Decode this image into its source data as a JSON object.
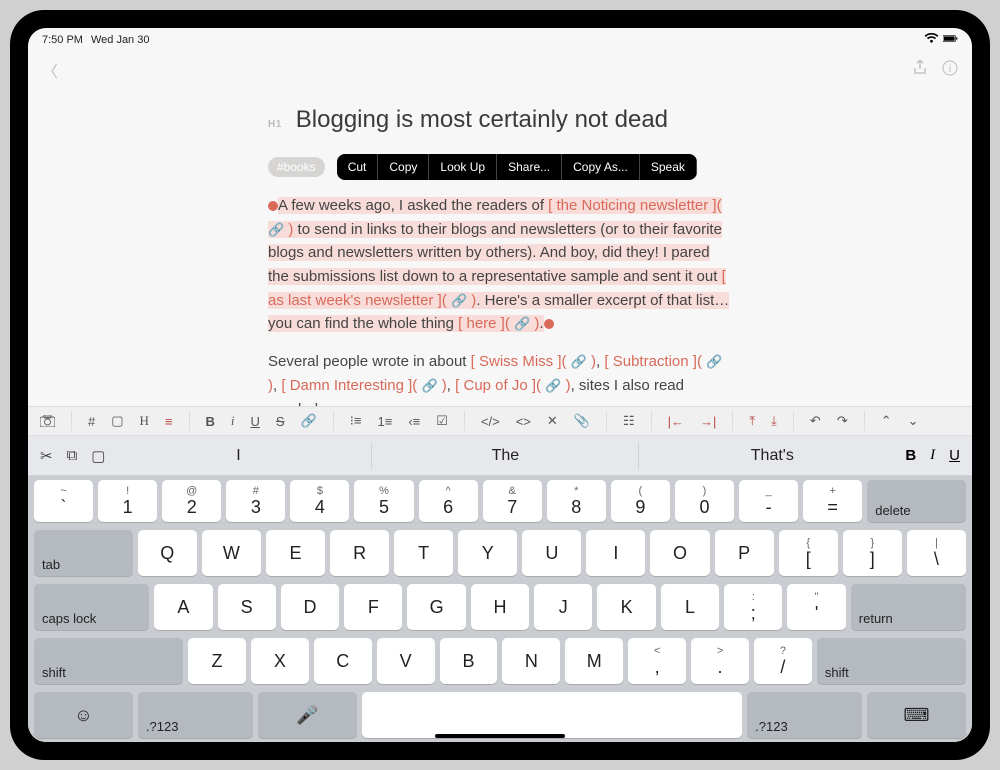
{
  "status": {
    "time": "7:50 PM",
    "date": "Wed Jan 30"
  },
  "doc": {
    "h1_marker": "H1",
    "title": "Blogging is most certainly not dead",
    "tag": "#books",
    "p1": {
      "a": "A few weeks ago, I asked the readers of ",
      "l1": "the Noticing newsletter",
      "b": " to send in links to their blogs and newsletters (or to their favorite blogs and newsletters written by others). And boy, did they! I pared the submissions list down to a representative sample and sent it out ",
      "l2": "as last week's newsletter",
      "c": ". Here's a smaller excerpt of that list…you can find the whole thing ",
      "l3": "here",
      "d": "."
    },
    "p2": {
      "a": "Several people wrote in about ",
      "l1": "Swiss Miss",
      "b": ", ",
      "l2": "Subtraction",
      "c": ", ",
      "l3": "Damn Interesting",
      "d": ", ",
      "l4": "Cup of Jo",
      "e": ", sites I also read regularly."
    }
  },
  "context_menu": [
    "Cut",
    "Copy",
    "Look Up",
    "Share...",
    "Copy As...",
    "Speak"
  ],
  "suggestions": [
    "I",
    "The",
    "That's"
  ],
  "format": {
    "b": "B",
    "i": "I",
    "u": "U"
  },
  "keys": {
    "row1": [
      {
        "t": "~",
        "m": "`"
      },
      {
        "t": "!",
        "m": "1"
      },
      {
        "t": "@",
        "m": "2"
      },
      {
        "t": "#",
        "m": "3"
      },
      {
        "t": "$",
        "m": "4"
      },
      {
        "t": "%",
        "m": "5"
      },
      {
        "t": "^",
        "m": "6"
      },
      {
        "t": "&",
        "m": "7"
      },
      {
        "t": "*",
        "m": "8"
      },
      {
        "t": "(",
        "m": "9"
      },
      {
        "t": ")",
        "m": "0"
      },
      {
        "t": "_",
        "m": "-"
      },
      {
        "t": "+",
        "m": "="
      }
    ],
    "delete": "delete",
    "tab": "tab",
    "row2": [
      "Q",
      "W",
      "E",
      "R",
      "T",
      "Y",
      "U",
      "I",
      "O",
      "P"
    ],
    "row2end": [
      {
        "t": "{",
        "m": "["
      },
      {
        "t": "}",
        "m": "]"
      },
      {
        "t": "|",
        "m": "\\"
      }
    ],
    "caps": "caps lock",
    "row3": [
      "A",
      "S",
      "D",
      "F",
      "G",
      "H",
      "J",
      "K",
      "L"
    ],
    "row3end": [
      {
        "t": ":",
        "m": ";"
      },
      {
        "t": "\"",
        "m": "'"
      }
    ],
    "return": "return",
    "shift": "shift",
    "row4": [
      "Z",
      "X",
      "C",
      "V",
      "B",
      "N",
      "M"
    ],
    "row4end": [
      {
        "t": "<",
        "m": ","
      },
      {
        "t": ">",
        "m": "."
      },
      {
        "t": "?",
        "m": "/"
      }
    ],
    "numkey": ".?123"
  }
}
